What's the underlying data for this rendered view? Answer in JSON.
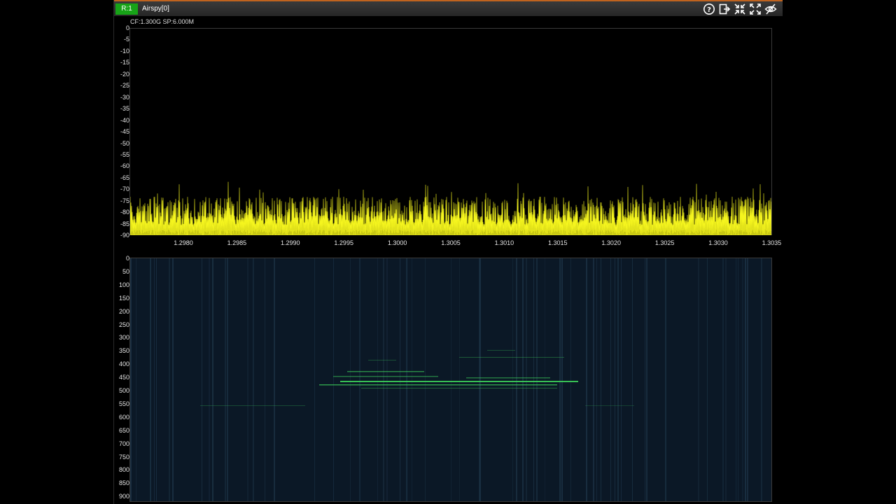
{
  "titlebar": {
    "radio_badge": "R:1",
    "device_name": "Airspy[0]",
    "icons": [
      "help-icon",
      "export-icon",
      "collapse-icon",
      "expand-icon",
      "hide-icon"
    ]
  },
  "spectrum": {
    "info": "CF:1.300G SP:6.000M",
    "trace_color": "#f5f51e",
    "y_labels": [
      "0",
      "-5",
      "-10",
      "-15",
      "-20",
      "-25",
      "-30",
      "-35",
      "-40",
      "-45",
      "-50",
      "-55",
      "-60",
      "-65",
      "-70",
      "-75",
      "-80",
      "-85",
      "-90"
    ],
    "x_labels": [
      "1.2980",
      "1.2985",
      "1.2990",
      "1.2995",
      "1.3000",
      "1.3005",
      "1.3010",
      "1.3015",
      "1.3020",
      "1.3025",
      "1.3030",
      "1.3035"
    ]
  },
  "waterfall": {
    "background": "#0b1826",
    "signal_color": "#3cd25a",
    "y_labels": [
      "0",
      "50",
      "100",
      "150",
      "200",
      "250",
      "300",
      "350",
      "400",
      "450",
      "500",
      "550",
      "600",
      "650",
      "700",
      "750",
      "800",
      "850",
      "900"
    ]
  },
  "colors": {
    "badge": "#17a317",
    "title_accent": "#c0631e"
  }
}
